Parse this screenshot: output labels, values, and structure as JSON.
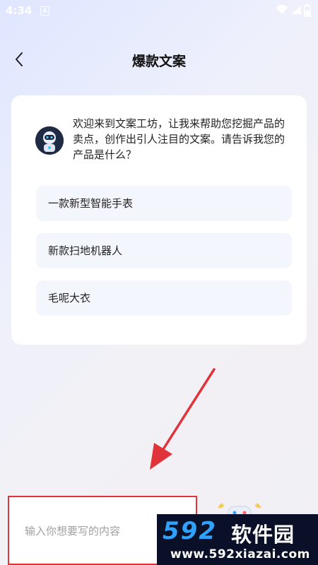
{
  "status_bar": {
    "time": "4:34",
    "sim_label": "A"
  },
  "header": {
    "title": "爆款文案"
  },
  "chat": {
    "intro": "欢迎来到文案工坊，让我来帮助您挖掘产品的卖点，创作出引人注目的文案。请告诉我您的产品是什么？",
    "suggestions": [
      "一款新型智能手表",
      "新款扫地机器人",
      "毛呢大衣"
    ]
  },
  "input": {
    "placeholder": "输入你想要写的内容"
  },
  "watermark": {
    "brand": "592",
    "name": "软件园",
    "url": "www.592xiazai.com"
  },
  "colors": {
    "annotation_red": "#e0343a",
    "suggestion_bg": "#f3f6fd",
    "watermark_blue": "#2fa2ff"
  }
}
